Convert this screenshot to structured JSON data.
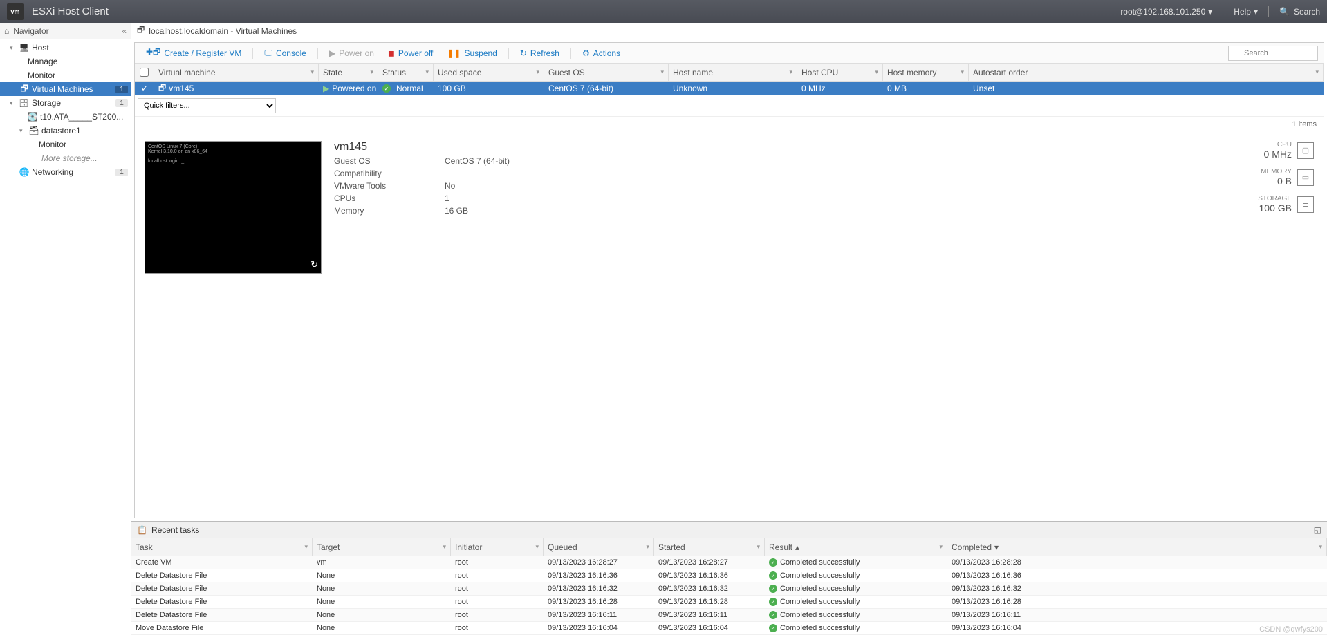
{
  "topbar": {
    "app_title": "ESXi Host Client",
    "user": "root@192.168.101.250",
    "help": "Help",
    "search": "Search"
  },
  "nav": {
    "title": "Navigator",
    "items": {
      "host": "Host",
      "manage": "Manage",
      "monitor": "Monitor",
      "vms": "Virtual Machines",
      "vms_count": "1",
      "storage": "Storage",
      "storage_count": "1",
      "disk": "t10.ATA_____ST200...",
      "datastore": "datastore1",
      "ds_monitor": "Monitor",
      "more_storage": "More storage...",
      "networking": "Networking",
      "networking_count": "1"
    }
  },
  "breadcrumb": "localhost.localdomain - Virtual Machines",
  "toolbar": {
    "create": "Create / Register VM",
    "console": "Console",
    "power_on": "Power on",
    "power_off": "Power off",
    "suspend": "Suspend",
    "refresh": "Refresh",
    "actions": "Actions",
    "search_ph": "Search"
  },
  "grid": {
    "cols": [
      "Virtual machine",
      "State",
      "Status",
      "Used space",
      "Guest OS",
      "Host name",
      "Host CPU",
      "Host memory",
      "Autostart order"
    ],
    "row": {
      "name": "vm145",
      "state": "Powered on",
      "status": "Normal",
      "space": "100 GB",
      "guest": "CentOS 7 (64-bit)",
      "hostname": "Unknown",
      "cpu": "0 MHz",
      "mem": "0 MB",
      "auto": "Unset"
    },
    "filter_ph": "Quick filters...",
    "items": "1 items"
  },
  "details": {
    "title": "vm145",
    "rows": [
      {
        "k": "Guest OS",
        "v": "CentOS 7 (64-bit)"
      },
      {
        "k": "Compatibility",
        "v": ""
      },
      {
        "k": "VMware Tools",
        "v": "No"
      },
      {
        "k": "CPUs",
        "v": "1"
      },
      {
        "k": "Memory",
        "v": "16 GB"
      }
    ],
    "stats": {
      "cpu_l": "CPU",
      "cpu_v": "0 MHz",
      "mem_l": "MEMORY",
      "mem_v": "0 B",
      "stor_l": "STORAGE",
      "stor_v": "100 GB"
    }
  },
  "tasks": {
    "title": "Recent tasks",
    "cols": [
      "Task",
      "Target",
      "Initiator",
      "Queued",
      "Started",
      "Result",
      "Completed"
    ],
    "rows": [
      {
        "task": "Create VM",
        "target": "vm",
        "init": "root",
        "q": "09/13/2023 16:28:27",
        "s": "09/13/2023 16:28:27",
        "r": "Completed successfully",
        "c": "09/13/2023 16:28:28"
      },
      {
        "task": "Delete Datastore File",
        "target": "None",
        "init": "root",
        "q": "09/13/2023 16:16:36",
        "s": "09/13/2023 16:16:36",
        "r": "Completed successfully",
        "c": "09/13/2023 16:16:36"
      },
      {
        "task": "Delete Datastore File",
        "target": "None",
        "init": "root",
        "q": "09/13/2023 16:16:32",
        "s": "09/13/2023 16:16:32",
        "r": "Completed successfully",
        "c": "09/13/2023 16:16:32"
      },
      {
        "task": "Delete Datastore File",
        "target": "None",
        "init": "root",
        "q": "09/13/2023 16:16:28",
        "s": "09/13/2023 16:16:28",
        "r": "Completed successfully",
        "c": "09/13/2023 16:16:28"
      },
      {
        "task": "Delete Datastore File",
        "target": "None",
        "init": "root",
        "q": "09/13/2023 16:16:11",
        "s": "09/13/2023 16:16:11",
        "r": "Completed successfully",
        "c": "09/13/2023 16:16:11"
      },
      {
        "task": "Move Datastore File",
        "target": "None",
        "init": "root",
        "q": "09/13/2023 16:16:04",
        "s": "09/13/2023 16:16:04",
        "r": "Completed successfully",
        "c": "09/13/2023 16:16:04"
      }
    ]
  },
  "watermark": "CSDN @qwfys200"
}
